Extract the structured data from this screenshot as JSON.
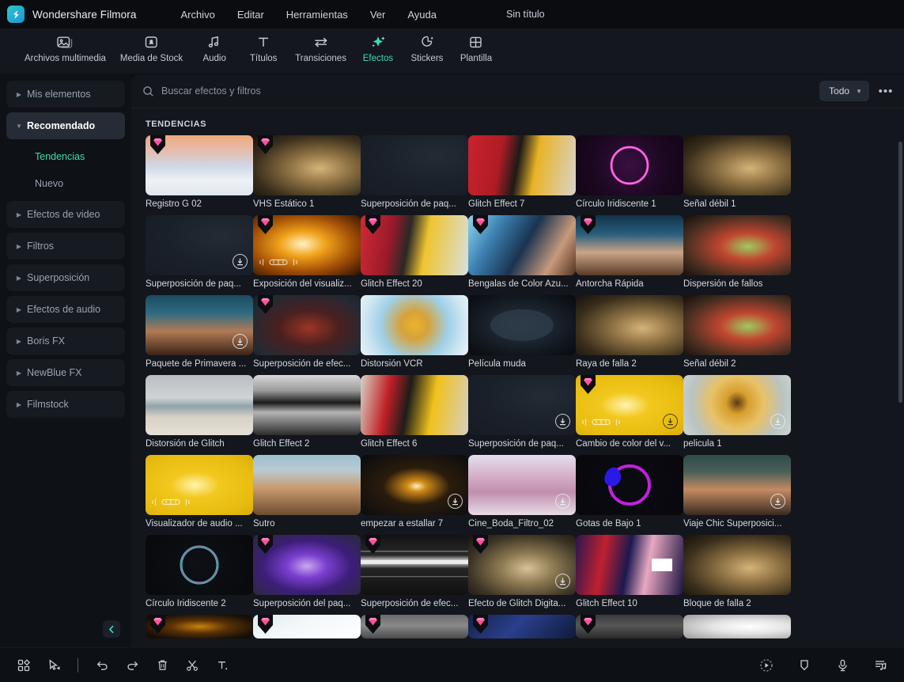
{
  "titlebar": {
    "app_name": "Wondershare Filmora",
    "logo_icon": "filmora-logo-icon",
    "document_title": "Sin título",
    "menus": [
      {
        "label": "Archivo"
      },
      {
        "label": "Editar"
      },
      {
        "label": "Herramientas"
      },
      {
        "label": "Ver"
      },
      {
        "label": "Ayuda"
      }
    ]
  },
  "tooltabs": {
    "active": "Efectos",
    "items": [
      {
        "label": "Archivos multimedia",
        "icon": "media-files-icon"
      },
      {
        "label": "Media de Stock",
        "icon": "stock-media-icon"
      },
      {
        "label": "Audio",
        "icon": "music-note-icon"
      },
      {
        "label": "Títulos",
        "icon": "text-title-icon"
      },
      {
        "label": "Transiciones",
        "icon": "transitions-arrows-icon"
      },
      {
        "label": "Efectos",
        "icon": "effects-sparkle-icon"
      },
      {
        "label": "Stickers",
        "icon": "stickers-icon"
      },
      {
        "label": "Plantilla",
        "icon": "template-grid-icon"
      }
    ]
  },
  "sidebar": {
    "items": [
      {
        "label": "Mis elementos",
        "type": "group",
        "expanded": false
      },
      {
        "label": "Recomendado",
        "type": "group",
        "expanded": true,
        "selected": true
      },
      {
        "label": "Tendencias",
        "type": "sub",
        "active": true
      },
      {
        "label": "Nuevo",
        "type": "sub",
        "active": false
      },
      {
        "label": "Efectos de video",
        "type": "group",
        "expanded": false
      },
      {
        "label": "Filtros",
        "type": "group",
        "expanded": false
      },
      {
        "label": "Superposición",
        "type": "group",
        "expanded": false
      },
      {
        "label": "Efectos de audio",
        "type": "group",
        "expanded": false
      },
      {
        "label": "Boris FX",
        "type": "group",
        "expanded": false
      },
      {
        "label": "NewBlue FX",
        "type": "group",
        "expanded": false
      },
      {
        "label": "Filmstock",
        "type": "group",
        "expanded": false
      }
    ],
    "collapse_icon": "chevron-left-icon"
  },
  "search": {
    "icon": "search-icon",
    "placeholder": "Buscar efectos y filtros",
    "value": ""
  },
  "filter": {
    "label": "Todo",
    "chevron_icon": "chevron-down-icon",
    "more_icon": "more-horizontal-icon",
    "more_label": "•••"
  },
  "content": {
    "section_title": "TENDENCIAS",
    "cards": [
      {
        "label": "Registro G 02",
        "pro": true,
        "download": false,
        "art": "bridge"
      },
      {
        "label": "VHS Estático 1",
        "pro": true,
        "download": false,
        "art": "woman-warm"
      },
      {
        "label": "Superposición de paq...",
        "pro": false,
        "download": false,
        "art": "dark-particles"
      },
      {
        "label": "Glitch Effect 7",
        "pro": false,
        "download": false,
        "art": "red-train"
      },
      {
        "label": "Círculo Iridiscente 1",
        "pro": false,
        "download": false,
        "art": "magenta-ring"
      },
      {
        "label": "Señal débil 1",
        "pro": false,
        "download": false,
        "art": "woman-warm"
      },
      {
        "label": "Superposición de paq...",
        "pro": false,
        "download": true,
        "art": "dark-particles"
      },
      {
        "label": "Exposición del visualiz...",
        "pro": true,
        "download": false,
        "art": "orange-burst",
        "audio": true
      },
      {
        "label": "Glitch Effect 20",
        "pro": true,
        "download": false,
        "art": "red-train-rgb"
      },
      {
        "label": "Bengalas de Color Azu...",
        "pro": true,
        "download": false,
        "art": "blue-flare"
      },
      {
        "label": "Antorcha Rápida",
        "pro": true,
        "download": false,
        "art": "mountain-flare"
      },
      {
        "label": "Dispersión de fallos",
        "pro": false,
        "download": false,
        "art": "woman-rgb"
      },
      {
        "label": "Paquete de Primavera ...",
        "pro": false,
        "download": true,
        "art": "spring-bokeh"
      },
      {
        "label": "Superposición de efec...",
        "pro": true,
        "download": false,
        "art": "red-dust"
      },
      {
        "label": "Distorsión VCR",
        "pro": false,
        "download": false,
        "art": "flower-vcr"
      },
      {
        "label": "Película muda",
        "pro": false,
        "download": false,
        "art": "silent-film"
      },
      {
        "label": "Raya de falla 2",
        "pro": false,
        "download": false,
        "art": "woman-warm"
      },
      {
        "label": "Señal débil 2",
        "pro": false,
        "download": false,
        "art": "woman-rgb"
      },
      {
        "label": "Distorsión de Glitch",
        "pro": false,
        "download": false,
        "art": "beach-glitch"
      },
      {
        "label": "Glitch Effect 2",
        "pro": false,
        "download": false,
        "art": "bw-glitch"
      },
      {
        "label": "Glitch Effect 6",
        "pro": false,
        "download": false,
        "art": "yellow-train"
      },
      {
        "label": "Superposición de paq...",
        "pro": false,
        "download": true,
        "art": "dark-particles"
      },
      {
        "label": "Cambio de color del v...",
        "pro": true,
        "download": true,
        "art": "yellow-rgb",
        "audio": true,
        "dark_dl": true
      },
      {
        "label": "pelicula 1",
        "pro": false,
        "download": true,
        "art": "gold-flower"
      },
      {
        "label": "Visualizador de audio ...",
        "pro": false,
        "download": false,
        "art": "yellow-rgb",
        "audio": true
      },
      {
        "label": "Sutro",
        "pro": false,
        "download": false,
        "art": "sutro"
      },
      {
        "label": "empezar a estallar 7",
        "pro": false,
        "download": true,
        "art": "spark-night"
      },
      {
        "label": "Cine_Boda_Filtro_02",
        "pro": false,
        "download": true,
        "art": "pink-cathedral"
      },
      {
        "label": "Gotas de Bajo 1",
        "pro": false,
        "download": false,
        "art": "blue-blob"
      },
      {
        "label": "Viaje Chic Superposici...",
        "pro": false,
        "download": true,
        "art": "mountain-dusk"
      },
      {
        "label": "Círculo Iridiscente 2",
        "pro": false,
        "download": false,
        "art": "teal-ring"
      },
      {
        "label": "Superposición del paq...",
        "pro": true,
        "download": false,
        "art": "purple-figure"
      },
      {
        "label": "Superposición de efec...",
        "pro": true,
        "download": false,
        "art": "bw-noise"
      },
      {
        "label": "Efecto de Glitch Digita...",
        "pro": true,
        "download": true,
        "art": "woman-tvglitch"
      },
      {
        "label": "Glitch Effect 10",
        "pro": false,
        "download": false,
        "art": "magenta-train"
      },
      {
        "label": "Bloque de falla 2",
        "pro": false,
        "download": false,
        "art": "woman-warm"
      }
    ],
    "partial_row": [
      {
        "label": "",
        "pro": true,
        "art": "gold-sparks"
      },
      {
        "label": "",
        "pro": true,
        "art": "white-bright"
      },
      {
        "label": "",
        "pro": true,
        "art": "grey-soft"
      },
      {
        "label": "",
        "pro": true,
        "art": "blue-deep"
      },
      {
        "label": "",
        "pro": true,
        "art": "grey-dark"
      },
      {
        "label": "",
        "pro": false,
        "art": "white-feather"
      }
    ]
  },
  "bottombar": {
    "left_tools": [
      {
        "icon": "layout-grid-icon",
        "label": "Diseño"
      },
      {
        "icon": "select-cursor-icon",
        "label": "Seleccionar"
      },
      {
        "icon": "separator",
        "label": ""
      },
      {
        "icon": "undo-icon",
        "label": "Deshacer"
      },
      {
        "icon": "redo-icon",
        "label": "Rehacer"
      },
      {
        "icon": "delete-trash-icon",
        "label": "Eliminar"
      },
      {
        "icon": "scissors-cut-icon",
        "label": "Cortar"
      },
      {
        "icon": "text-tool-icon",
        "label": "Texto"
      }
    ],
    "right_tools": [
      {
        "icon": "render-preview-icon",
        "label": "Renderizar vista previa"
      },
      {
        "icon": "marker-icon",
        "label": "Marcador"
      },
      {
        "icon": "microphone-icon",
        "label": "Grabar voz"
      },
      {
        "icon": "audio-mixer-icon",
        "label": "Mezclador de audio"
      }
    ]
  },
  "colors": {
    "accent": "#3ddbb0",
    "pro_badge": "#ff5fa2",
    "panel_bg": "#13161c",
    "sidebar_bg": "#0e1116",
    "titlebar_bg": "#0a0c10"
  }
}
